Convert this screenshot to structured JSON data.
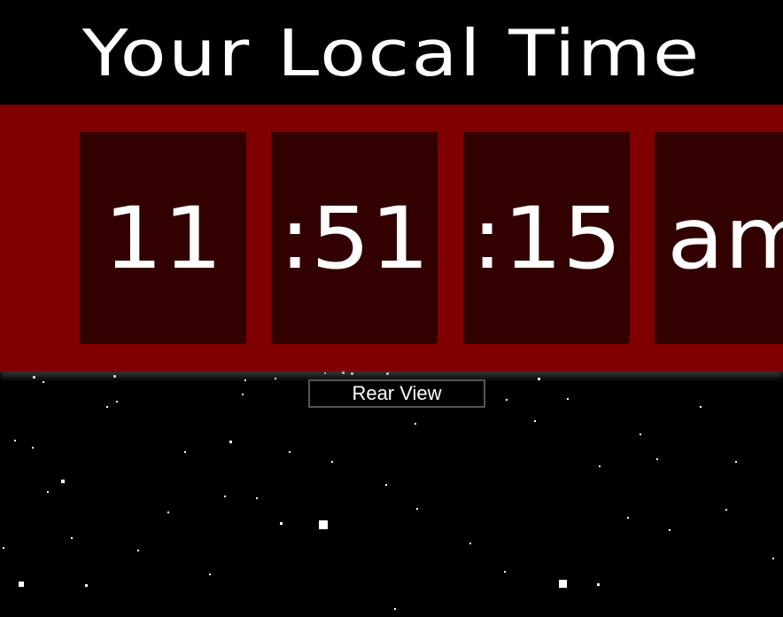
{
  "page": {
    "title": "Your Local Time"
  },
  "clock": {
    "hours": "11",
    "minutes": ":51",
    "seconds": ":15",
    "period": "am"
  },
  "controls": {
    "rear_view_label": "Rear View"
  },
  "colors": {
    "background": "#000000",
    "band": "#800000",
    "tile": "#330000",
    "text": "#ffffff"
  }
}
